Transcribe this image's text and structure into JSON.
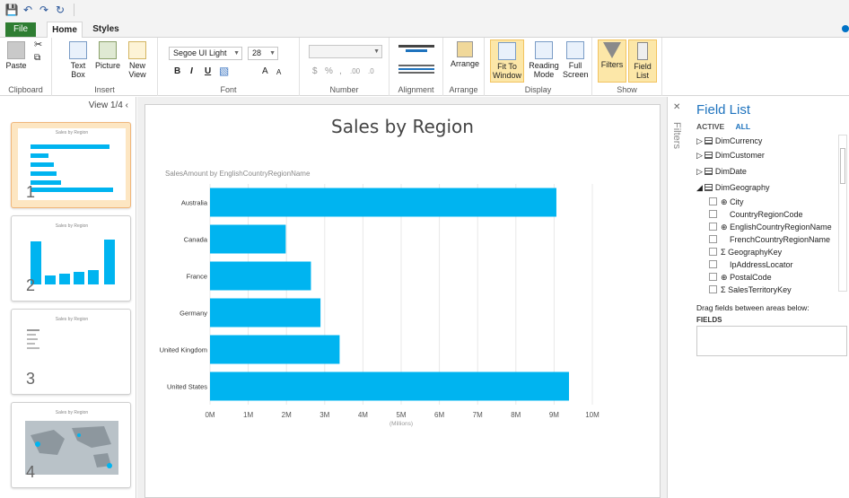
{
  "ribbon_tabs": {
    "file": "File",
    "home": "Home",
    "styles": "Styles"
  },
  "ribbon": {
    "clipboard": {
      "label": "Clipboard",
      "paste": "Paste"
    },
    "insert": {
      "label": "Insert",
      "text_box": "Text Box",
      "picture": "Picture",
      "new_view": "New View"
    },
    "font": {
      "label": "Font",
      "family": "Segoe UI Light",
      "size": "28",
      "bold": "B",
      "italic": "I",
      "underline": "U",
      "grow": "A",
      "shrink": "A"
    },
    "number": {
      "label": "Number",
      "currency": "$",
      "percent": "%",
      "comma": ",",
      "inc_dec": ".00",
      "dec_dec": ".0"
    },
    "alignment": {
      "label": "Alignment"
    },
    "arrange": {
      "label": "Arrange",
      "arrange": "Arrange"
    },
    "display": {
      "label": "Display",
      "fit_to_window": "Fit To Window",
      "reading_mode": "Reading Mode",
      "full_screen": "Full Screen"
    },
    "show": {
      "label": "Show",
      "filters": "Filters",
      "field_list": "Field List"
    }
  },
  "views": {
    "label": "View 1/4",
    "items": [
      {
        "num": "1",
        "title": "Sales by Region"
      },
      {
        "num": "2",
        "title": "Sales by Region"
      },
      {
        "num": "3",
        "title": "Sales by Region"
      },
      {
        "num": "4",
        "title": "Sales by Region"
      }
    ]
  },
  "canvas": {
    "title": "Sales by Region",
    "subtitle": "SalesAmount by EnglishCountryRegionName",
    "filters_label": "Filters"
  },
  "chart_data": {
    "type": "bar",
    "orientation": "horizontal",
    "categories": [
      "Australia",
      "Canada",
      "France",
      "Germany",
      "United Kingdom",
      "United States"
    ],
    "values": [
      9.06,
      1.98,
      2.64,
      2.89,
      3.39,
      9.39
    ],
    "xticks": [
      "0M",
      "1M",
      "2M",
      "3M",
      "4M",
      "5M",
      "6M",
      "7M",
      "8M",
      "9M",
      "10M"
    ],
    "xunit": "(Millions)",
    "xlim": [
      0,
      10
    ],
    "color": "#00b4f0"
  },
  "field_list": {
    "title": "Field List",
    "tab_active": "ACTIVE",
    "tab_all": "ALL",
    "tables": [
      "DimCurrency",
      "DimCustomer",
      "DimDate",
      "DimGeography"
    ],
    "fields": [
      "City",
      "CountryRegionCode",
      "EnglishCountryRegionName",
      "FrenchCountryRegionName",
      "GeographyKey",
      "IpAddressLocator",
      "PostalCode",
      "SalesTerritoryKey"
    ],
    "drag_label": "Drag fields between areas below:",
    "fields_area": "FIELDS"
  }
}
